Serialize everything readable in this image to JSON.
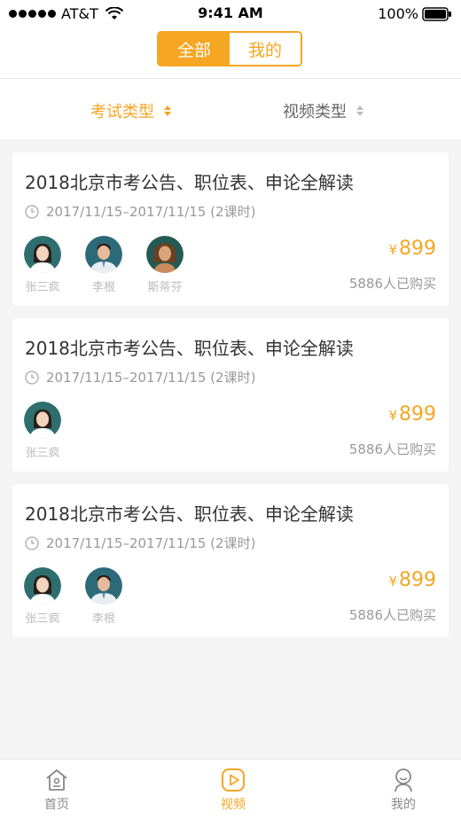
{
  "status_bar": {
    "carrier": "AT&T",
    "time": "9:41 AM",
    "battery": "100%"
  },
  "segmented": {
    "all_label": "全部",
    "mine_label": "我的"
  },
  "filters": {
    "exam_type": "考试类型",
    "video_type": "视频类型"
  },
  "colors": {
    "accent": "#f5a623",
    "background": "#f4f4f4"
  },
  "courses": [
    {
      "title": "2018北京市考公告、职位表、申论全解读",
      "time": "2017/11/15–2017/11/15 (2课时)",
      "teachers": [
        "张三疯",
        "李根",
        "斯蒂芬"
      ],
      "price_currency": "¥",
      "price": "899",
      "purchased": "5886人已购买"
    },
    {
      "title": "2018北京市考公告、职位表、申论全解读",
      "time": "2017/11/15–2017/11/15 (2课时)",
      "teachers": [
        "张三疯"
      ],
      "price_currency": "¥",
      "price": "899",
      "purchased": "5886人已购买"
    },
    {
      "title": "2018北京市考公告、职位表、申论全解读",
      "time": "2017/11/15–2017/11/15 (2课时)",
      "teachers": [
        "张三疯",
        "李根"
      ],
      "price_currency": "¥",
      "price": "899",
      "purchased": "5886人已购买"
    }
  ],
  "tabs": {
    "home": "首页",
    "video": "视频",
    "mine": "我的"
  }
}
